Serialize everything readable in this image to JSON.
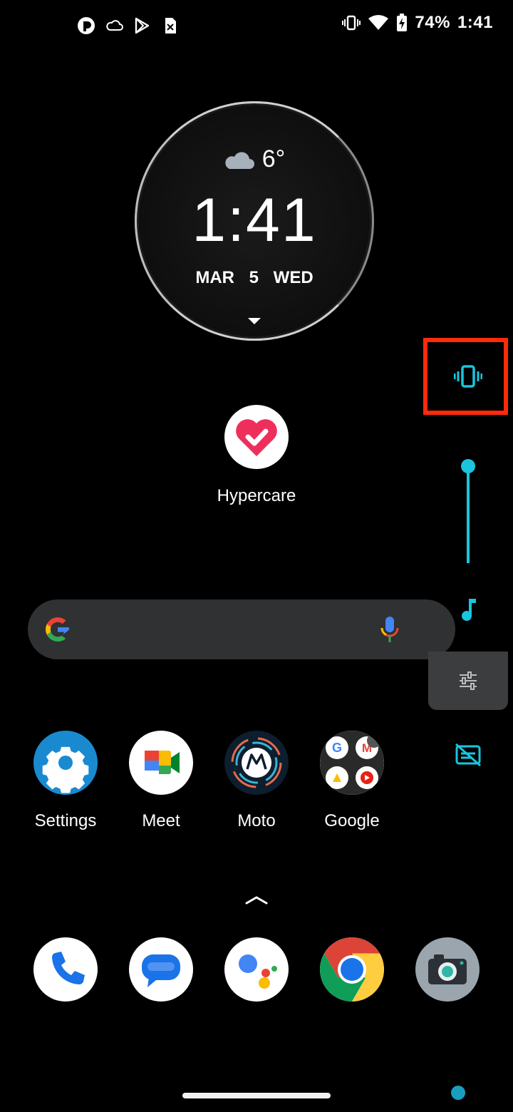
{
  "status_bar": {
    "battery": "74%",
    "time": "1:41",
    "left_icons": [
      "app-c-icon",
      "cloud-icon",
      "play-store-icon",
      "sim-icon"
    ],
    "right_icons": [
      "vibrate-icon",
      "wifi-icon",
      "battery-charging-icon"
    ]
  },
  "clock_widget": {
    "temperature": "6°",
    "time": "1:41",
    "date": "MAR 5 WED"
  },
  "hypercare": {
    "label": "Hypercare"
  },
  "search": {
    "placeholder": ""
  },
  "volume_panel": {
    "mode": "vibrate",
    "level": 1.0,
    "accent": "#19c6dd",
    "highlight": "#ff2a0a"
  },
  "apps": [
    {
      "label": "Settings"
    },
    {
      "label": "Meet"
    },
    {
      "label": "Moto"
    },
    {
      "label": "Google"
    }
  ],
  "dock": [
    "Phone",
    "Messages",
    "Assistant",
    "Chrome",
    "Camera"
  ]
}
